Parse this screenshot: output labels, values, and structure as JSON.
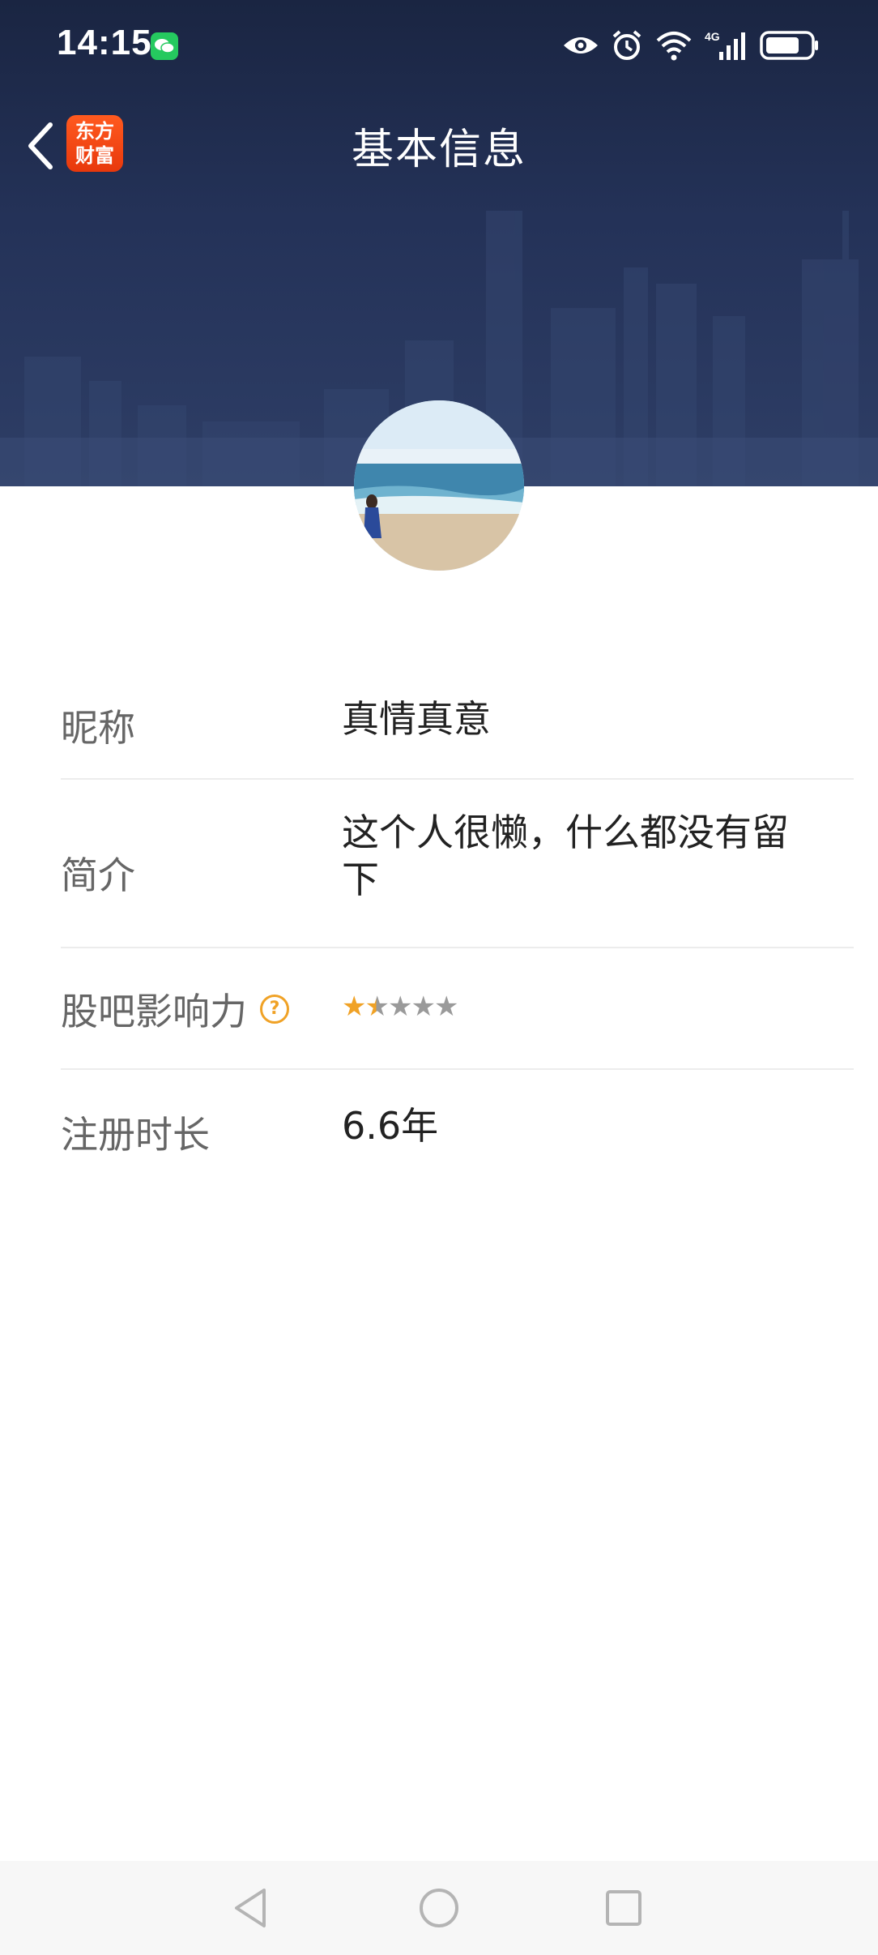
{
  "status_bar": {
    "time": "14:15",
    "icons": [
      "wechat-icon",
      "eye-icon",
      "alarm-icon",
      "wifi-icon",
      "signal-4g-icon",
      "battery-icon"
    ],
    "network_label": "4G"
  },
  "nav": {
    "title": "基本信息",
    "app_badge_line1": "东方",
    "app_badge_line2": "财富"
  },
  "profile": {
    "nickname_label": "昵称",
    "nickname": "真情真意",
    "bio_label": "简介",
    "bio": "这个人很懒，什么都没有留下",
    "influence_label": "股吧影响力",
    "influence_help": "?",
    "influence_rating": 1.5,
    "influence_max": 5,
    "register_label": "注册时长",
    "register_value": "6.6年"
  },
  "colors": {
    "header_bg": "#1a2542",
    "accent": "#f0a226",
    "badge": "#ff5a1f"
  }
}
